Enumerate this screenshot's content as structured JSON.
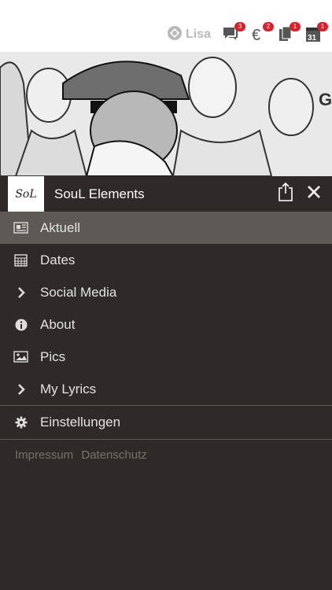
{
  "statusbar": {
    "username": "Lisa",
    "icons": [
      {
        "name": "messages-icon",
        "badge": "3"
      },
      {
        "name": "euro-icon",
        "badge": "2"
      },
      {
        "name": "documents-icon",
        "badge": "1"
      },
      {
        "name": "calendar-icon",
        "badge": "1",
        "date": "31"
      }
    ]
  },
  "header": {
    "logo_text": "SoL",
    "title": "SouL Elements"
  },
  "menu": {
    "items": [
      {
        "label": "Aktuell",
        "icon": "newspaper-icon",
        "active": true
      },
      {
        "label": "Dates",
        "icon": "calendar-grid-icon",
        "active": false
      },
      {
        "label": "Social Media",
        "icon": "chevron-right-icon",
        "active": false
      },
      {
        "label": "About",
        "icon": "info-icon",
        "active": false
      },
      {
        "label": "Pics",
        "icon": "image-icon",
        "active": false
      },
      {
        "label": "My Lyrics",
        "icon": "chevron-right-icon",
        "active": false
      }
    ],
    "settings_label": "Einstellungen"
  },
  "footer": {
    "impressum": "Impressum",
    "datenschutz": "Datenschutz"
  },
  "colors": {
    "background": "#2f2a27",
    "active_row": "#5e5955",
    "badge": "#d6222b"
  }
}
